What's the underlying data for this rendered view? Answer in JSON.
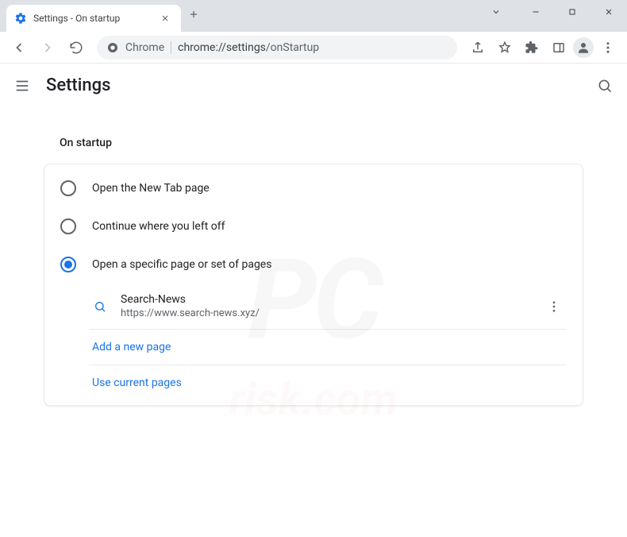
{
  "tab": {
    "title": "Settings - On startup"
  },
  "omnibox": {
    "prefix": "Chrome",
    "host": "chrome://settings",
    "path": "/onStartup"
  },
  "header": {
    "title": "Settings"
  },
  "section": {
    "title": "On startup"
  },
  "options": {
    "newtab": "Open the New Tab page",
    "continue": "Continue where you left off",
    "specific": "Open a specific page or set of pages"
  },
  "page_entry": {
    "name": "Search-News",
    "url": "https://www.search-news.xyz/"
  },
  "links": {
    "add": "Add a new page",
    "use_current": "Use current pages"
  }
}
